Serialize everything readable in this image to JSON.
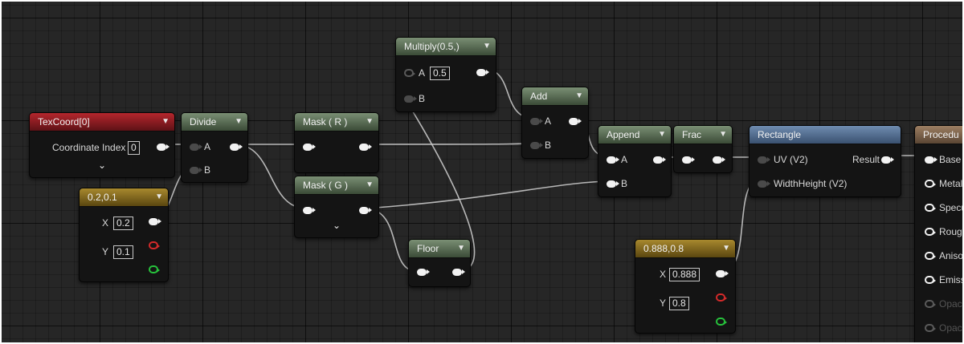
{
  "nodes": {
    "texcoord": {
      "title": "TexCoord[0]",
      "coordinate_label": "Coordinate Index",
      "coordinate_value": "0",
      "expand": "⌄"
    },
    "divide": {
      "title": "Divide",
      "a": "A",
      "b": "B"
    },
    "const1": {
      "title": "0.2,0.1",
      "x_label": "X",
      "x_value": "0.2",
      "y_label": "Y",
      "y_value": "0.1"
    },
    "multiply": {
      "title": "Multiply(0.5,)",
      "a": "A",
      "a_value": "0.5",
      "b": "B"
    },
    "mask_r": {
      "title": "Mask ( R )",
      "expand": "⌄"
    },
    "mask_g": {
      "title": "Mask ( G )",
      "expand": "⌄"
    },
    "add": {
      "title": "Add",
      "a": "A",
      "b": "B"
    },
    "append": {
      "title": "Append",
      "a": "A",
      "b": "B"
    },
    "frac": {
      "title": "Frac"
    },
    "floor": {
      "title": "Floor"
    },
    "rectangle": {
      "title": "Rectangle",
      "uv": "UV (V2)",
      "wh": "WidthHeight (V2)",
      "result": "Result"
    },
    "const2": {
      "title": "0.888,0.8",
      "x_label": "X",
      "x_value": "0.888",
      "y_label": "Y",
      "y_value": "0.8"
    },
    "procedural": {
      "title": "Procedu",
      "inputs": [
        "Base C",
        "Metall",
        "Specu",
        "Rough",
        "Aniso",
        "Emiss",
        "Opac",
        "Opaci"
      ]
    }
  },
  "icons": {
    "collapse": "chevron-down-icon"
  },
  "colors": {
    "texcoord": "#b5262d",
    "math": "#7a8f74",
    "constant": "#a8892e",
    "function": "#6f8cb0",
    "material": "#9c7e62"
  }
}
